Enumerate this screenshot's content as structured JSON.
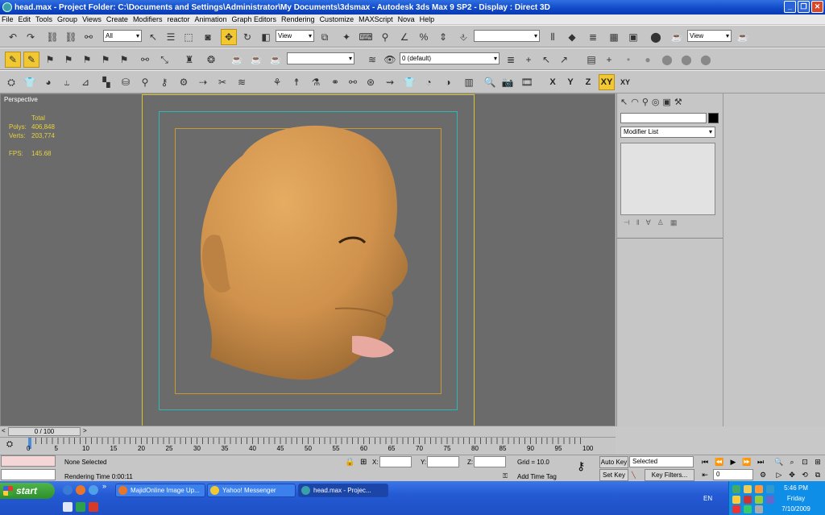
{
  "window": {
    "title": "head.max    - Project Folder: C:\\Documents and Settings\\Administrator\\My Documents\\3dsmax    - Autodesk 3ds Max 9 SP2     - Display : Direct 3D"
  },
  "menu": [
    "File",
    "Edit",
    "Tools",
    "Group",
    "Views",
    "Create",
    "Modifiers",
    "reactor",
    "Animation",
    "Graph Editors",
    "Rendering",
    "Customize",
    "MAXScript",
    "Nova",
    "Help"
  ],
  "toolbar": {
    "selection_filter": "All",
    "ref_coord": "View",
    "named_selection": "",
    "render_view": "View",
    "layer": "0 (default)",
    "axis_buttons": [
      "X",
      "Y",
      "Z",
      "XY",
      "XY"
    ]
  },
  "viewport": {
    "label": "Perspective",
    "stats": {
      "header": "Total",
      "polys_label": "Polys:",
      "polys_value": "406,848",
      "verts_label": "Verts:",
      "verts_value": "203,774",
      "fps_label": "FPS:",
      "fps_value": "145.68"
    },
    "colors": {
      "background": "#6b6b6b",
      "skin": "#d89a52",
      "safe_outer": "#d9c22b",
      "safe_mid": "#2fb7b7",
      "safe_inner": "#c79a30"
    }
  },
  "command_panel": {
    "modifier_list": "Modifier List"
  },
  "timeline": {
    "frame_display": "0 / 100",
    "ticks": [
      "0",
      "5",
      "10",
      "15",
      "20",
      "25",
      "30",
      "35",
      "40",
      "45",
      "50",
      "55",
      "60",
      "65",
      "70",
      "75",
      "80",
      "85",
      "90",
      "95",
      "100"
    ]
  },
  "status": {
    "selection": "None Selected",
    "rendering_time": "Rendering Time  0:00:11",
    "x_label": "X:",
    "y_label": "Y:",
    "z_label": "Z:",
    "grid": "Grid = 10.0",
    "add_time_tag": "Add Time Tag",
    "auto_key": "Auto Key",
    "set_key": "Set Key",
    "key_mode": "Selected",
    "key_filters": "Key Filters...",
    "current_frame": "0"
  },
  "taskbar": {
    "start": "start",
    "quick_launch_more": "»",
    "tasks": [
      "MajidOnline Image Up...",
      "Yahoo! Messenger",
      "head.max    - Projec..."
    ],
    "language": "EN",
    "time": "5:46 PM",
    "day": "Friday",
    "date": "7/10/2009"
  }
}
